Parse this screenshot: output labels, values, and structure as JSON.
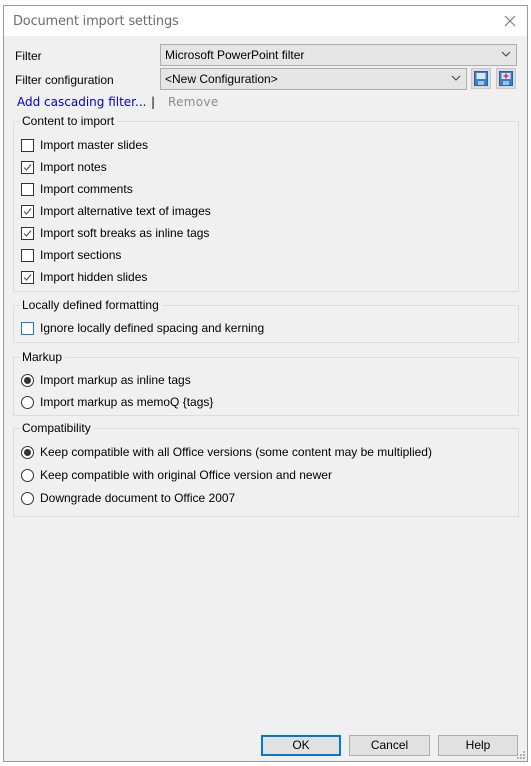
{
  "window": {
    "title": "Document import settings",
    "close_icon": "close-icon"
  },
  "filter": {
    "label": "Filter",
    "value": "Microsoft PowerPoint filter"
  },
  "filter_configuration": {
    "label": "Filter configuration",
    "value": "<New Configuration>",
    "save_icon": "save-icon",
    "save_as_icon": "save-as-icon"
  },
  "cascading": {
    "add_label": "Add cascading filter...",
    "separator": "|",
    "remove_label": "Remove"
  },
  "content_to_import": {
    "title": "Content to import",
    "options": [
      {
        "label": "Import master slides",
        "checked": false
      },
      {
        "label": "Import notes",
        "checked": true
      },
      {
        "label": "Import comments",
        "checked": false
      },
      {
        "label": "Import alternative text of images",
        "checked": true
      },
      {
        "label": "Import soft breaks as inline tags",
        "checked": true
      },
      {
        "label": "Import sections",
        "checked": false
      },
      {
        "label": "Import hidden slides",
        "checked": true
      }
    ]
  },
  "locally_defined_formatting": {
    "title": "Locally defined formatting",
    "options": [
      {
        "label": "Ignore locally defined spacing and kerning",
        "checked": false
      }
    ]
  },
  "markup": {
    "title": "Markup",
    "options": [
      {
        "label": "Import markup as inline tags",
        "selected": true
      },
      {
        "label": "Import markup as memoQ {tags}",
        "selected": false
      }
    ]
  },
  "compatibility": {
    "title": "Compatibility",
    "options": [
      {
        "label": "Keep compatible with all Office versions (some content may be multiplied)",
        "selected": true
      },
      {
        "label": "Keep compatible with original Office version and newer",
        "selected": false
      },
      {
        "label": "Downgrade document to Office 2007",
        "selected": false
      }
    ]
  },
  "buttons": {
    "ok": "OK",
    "cancel": "Cancel",
    "help": "Help"
  },
  "colors": {
    "link": "#0000cc",
    "focus": "#0078d7",
    "disabled_text": "#8c8c8c"
  }
}
